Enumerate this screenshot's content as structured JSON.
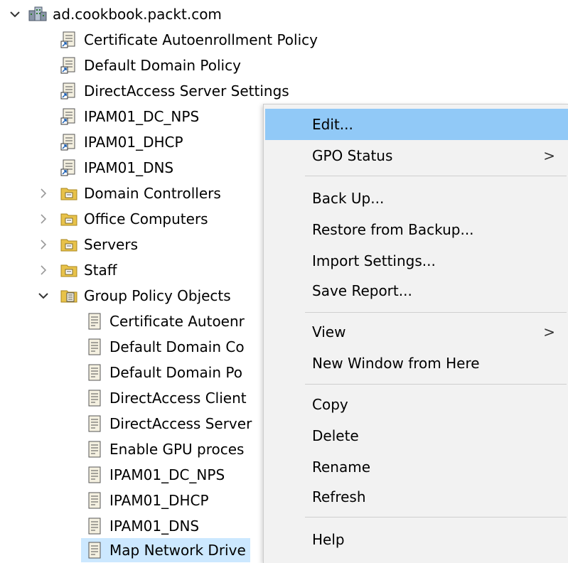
{
  "colors": {
    "menu_background": "#f2f2f2",
    "menu_highlight": "#91c9f7",
    "selection_background": "#cce8ff",
    "folder_yellow": "#e8c24a"
  },
  "tree": {
    "root": {
      "label": "ad.cookbook.packt.com",
      "icon": "domain-icon",
      "expanded": true
    },
    "linked_gpos": [
      {
        "label": "Certificate Autoenrollment Policy",
        "icon": "gpo-link-icon"
      },
      {
        "label": "Default Domain Policy",
        "icon": "gpo-link-icon"
      },
      {
        "label": "DirectAccess Server Settings",
        "icon": "gpo-link-icon"
      },
      {
        "label": "IPAM01_DC_NPS",
        "icon": "gpo-link-icon"
      },
      {
        "label": "IPAM01_DHCP",
        "icon": "gpo-link-icon"
      },
      {
        "label": "IPAM01_DNS",
        "icon": "gpo-link-icon"
      }
    ],
    "ous": [
      {
        "label": "Domain Controllers",
        "icon": "ou-folder-icon",
        "expanded": false
      },
      {
        "label": "Office Computers",
        "icon": "ou-folder-icon",
        "expanded": false
      },
      {
        "label": "Servers",
        "icon": "ou-folder-icon",
        "expanded": false
      },
      {
        "label": "Staff",
        "icon": "ou-folder-icon",
        "expanded": false
      }
    ],
    "gpo_container": {
      "label": "Group Policy Objects",
      "icon": "gpo-folder-icon",
      "expanded": true
    },
    "gpo_objects": [
      {
        "label": "Certificate Autoenr",
        "icon": "gpo-icon"
      },
      {
        "label": "Default Domain Co",
        "icon": "gpo-icon"
      },
      {
        "label": "Default Domain Po",
        "icon": "gpo-icon"
      },
      {
        "label": "DirectAccess Client",
        "icon": "gpo-icon"
      },
      {
        "label": "DirectAccess Server",
        "icon": "gpo-icon"
      },
      {
        "label": "Enable GPU proces",
        "icon": "gpo-icon"
      },
      {
        "label": "IPAM01_DC_NPS",
        "icon": "gpo-icon"
      },
      {
        "label": "IPAM01_DHCP",
        "icon": "gpo-icon"
      },
      {
        "label": "IPAM01_DNS",
        "icon": "gpo-icon"
      },
      {
        "label": "Map Network Drive",
        "icon": "gpo-icon",
        "selected": true
      }
    ]
  },
  "context_menu": {
    "groups": [
      [
        {
          "label": "Edit...",
          "highlighted": true
        },
        {
          "label": "GPO Status",
          "submenu": true
        }
      ],
      [
        {
          "label": "Back Up..."
        },
        {
          "label": "Restore from Backup..."
        },
        {
          "label": "Import Settings..."
        },
        {
          "label": "Save Report..."
        }
      ],
      [
        {
          "label": "View",
          "submenu": true
        },
        {
          "label": "New Window from Here"
        }
      ],
      [
        {
          "label": "Copy"
        },
        {
          "label": "Delete"
        },
        {
          "label": "Rename"
        },
        {
          "label": "Refresh"
        }
      ],
      [
        {
          "label": "Help"
        }
      ]
    ],
    "submenu_arrow": ">"
  }
}
